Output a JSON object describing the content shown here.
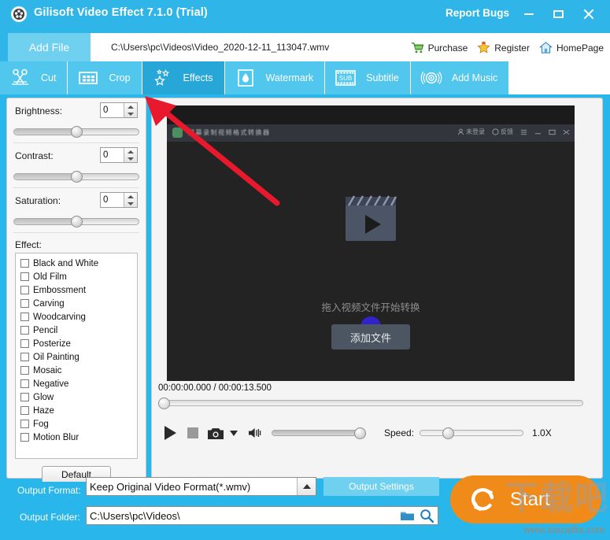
{
  "window": {
    "title": "Gilisoft Video Effect 7.1.0 (Trial)",
    "app_icon": "film-reel-icon",
    "report_bugs": "Report Bugs",
    "minimize": "minimize-icon",
    "maximize": "maximize-icon",
    "close": "close-icon",
    "titlebar_color": "#2fb5e8"
  },
  "filebar": {
    "add_file_label": "Add File",
    "file_path": "C:\\Users\\pc\\Videos\\Video_2020-12-11_113047.wmv",
    "actions": [
      {
        "label": "Purchase",
        "icon": "shopping-cart-icon"
      },
      {
        "label": "Register",
        "icon": "star-icon"
      },
      {
        "label": "HomePage",
        "icon": "home-icon"
      }
    ]
  },
  "tabs": [
    {
      "label": "Cut",
      "icon": "scissors-icon",
      "active": false
    },
    {
      "label": "Crop",
      "icon": "crop-frame-icon",
      "active": false
    },
    {
      "label": "Effects",
      "icon": "stars-icon",
      "active": true
    },
    {
      "label": "Watermark",
      "icon": "water-drop-icon",
      "active": false
    },
    {
      "label": "Subtitle",
      "icon": "sub-film-icon",
      "active": false
    },
    {
      "label": "Add Music",
      "icon": "speaker-icon",
      "active": false
    }
  ],
  "adjustments": [
    {
      "label": "Brightness:",
      "value": "0",
      "slider_percent": 50
    },
    {
      "label": "Contrast:",
      "value": "0",
      "slider_percent": 50
    },
    {
      "label": "Saturation:",
      "value": "0",
      "slider_percent": 50
    }
  ],
  "effects": {
    "label": "Effect:",
    "items": [
      {
        "label": "Black and White",
        "checked": false
      },
      {
        "label": "Old Film",
        "checked": false
      },
      {
        "label": "Embossment",
        "checked": false
      },
      {
        "label": "Carving",
        "checked": false
      },
      {
        "label": "Woodcarving",
        "checked": false
      },
      {
        "label": "Pencil",
        "checked": false
      },
      {
        "label": "Posterize",
        "checked": false
      },
      {
        "label": "Oil Painting",
        "checked": false
      },
      {
        "label": "Mosaic",
        "checked": false
      },
      {
        "label": "Negative",
        "checked": false
      },
      {
        "label": "Glow",
        "checked": false
      },
      {
        "label": "Haze",
        "checked": false
      },
      {
        "label": "Fog",
        "checked": false
      },
      {
        "label": "Motion Blur",
        "checked": false
      }
    ],
    "default_button": "Default"
  },
  "preview": {
    "inner_app_title": "屏幕录制视频格式转换器",
    "inner_hint": "拖入视频文件开始转换",
    "inner_add_button": "添加文件",
    "clapper_icon": "clapperboard-play-icon",
    "cursor_icon": "mouse-cursor-icon",
    "time_display": "00:00:00.000 / 00:00:13.500",
    "seek_percent": 0,
    "controls": {
      "play": "play-icon",
      "stop": "stop-icon",
      "snapshot": "camera-icon",
      "snapshot_dropdown": "caret-down-icon",
      "volume_icon": "volume-icon",
      "volume_percent": 100,
      "speed_label": "Speed:",
      "speed_percent": 27,
      "speed_value": "1.0X"
    }
  },
  "output": {
    "format_label": "Output Format:",
    "format_value": "Keep Original Video Format(*.wmv)",
    "settings_button": "Output Settings",
    "folder_label": "Output Folder:",
    "folder_value": "C:\\Users\\pc\\Videos\\",
    "folder_icon": "folder-icon",
    "browse_icon": "magnifier-icon",
    "start_button": "Start",
    "start_icon": "refresh-circular-icon",
    "start_color": "#f08a18"
  },
  "watermark": {
    "text": "下载吧",
    "url": "www.xiazaiba.com"
  }
}
